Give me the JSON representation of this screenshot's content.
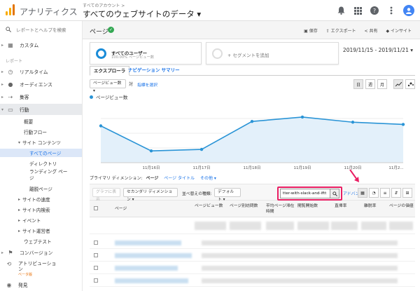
{
  "app": {
    "title": "アナリティクス",
    "account_path": "すべてのアカウント >",
    "view_title": "すべてのウェブサイトのデータ ▾"
  },
  "topbar_icons": [
    "bell-icon",
    "apps-grid-icon",
    "help-icon",
    "more-vert-icon",
    "avatar"
  ],
  "sidebar": {
    "search_help": "レポートとヘルプを検索",
    "custom": "カスタム",
    "section_report": "レポート",
    "items": [
      "リアルタイム",
      "オーディエンス",
      "集客",
      "行動"
    ],
    "behavior_sub": [
      "概要",
      "行動フロー"
    ],
    "site_content": "サイト コンテンツ",
    "site_content_sub": [
      "すべてのページ",
      "ディレクトリ",
      "ランディング ページ",
      "離脱ページ"
    ],
    "other_sub": [
      "サイトの速度",
      "サイト内検索",
      "イベント",
      "サイト運営者"
    ],
    "experiment": "ウェブテスト",
    "conversion": "コンバージョン",
    "attribution": "アトリビューション",
    "attribution_badge": "ベータ版",
    "discover": "発見"
  },
  "page": {
    "title": "ページ",
    "actions": [
      "保存",
      "エクスポート",
      "共有",
      "インサイト"
    ]
  },
  "segments": {
    "all_users_label": "すべてのユーザー",
    "all_users_sub": "100.00% ページビュー数",
    "add_segment": "+ セグメントを追加"
  },
  "date_range": "2019/11/15 - 2019/11/21 ▾",
  "tabs": [
    "エクスプローラ",
    "ナビゲーション サマリー"
  ],
  "metric_selector": {
    "value": "ページビュー数",
    "vs": "対",
    "select_metric": "指標を選択"
  },
  "time_buttons": [
    "日",
    "週",
    "月"
  ],
  "chart_legend": "ページビュー数",
  "chart_data": {
    "type": "area",
    "categories": [
      "11月15日",
      "11月16日",
      "11月17日",
      "11月18日",
      "11月19日",
      "11月20日",
      "11月21日"
    ],
    "x_tick_labels": [
      "11月16日",
      "11月17日",
      "11月18日",
      "11月19日",
      "11月20日",
      "11月2..."
    ],
    "values": [
      50,
      16,
      18,
      56,
      62,
      55,
      52
    ],
    "color": "#2a94d6",
    "ylim": [
      0,
      80
    ]
  },
  "dimension_row": {
    "label": "プライマリ ディメンション:",
    "page": "ページ",
    "page_title": "ページ タイトル",
    "other": "その他 ▾"
  },
  "filter_row": {
    "plot_rows": "グラフに表示",
    "secondary_dimension": "セカンダリ ディメンション ▾",
    "sort_type_label": "並べ替えの種類:",
    "sort_default": "デフォルト ▾",
    "search_value": "tter-with-slack-and-iftt",
    "advanced": "アドバンス"
  },
  "table": {
    "headers": [
      "ページ",
      "ページビュー数",
      "ページ別訪問数",
      "平均ページ滞在時間",
      "閲覧開始数",
      "直帰率",
      "離脱率",
      "ページの価値"
    ]
  }
}
